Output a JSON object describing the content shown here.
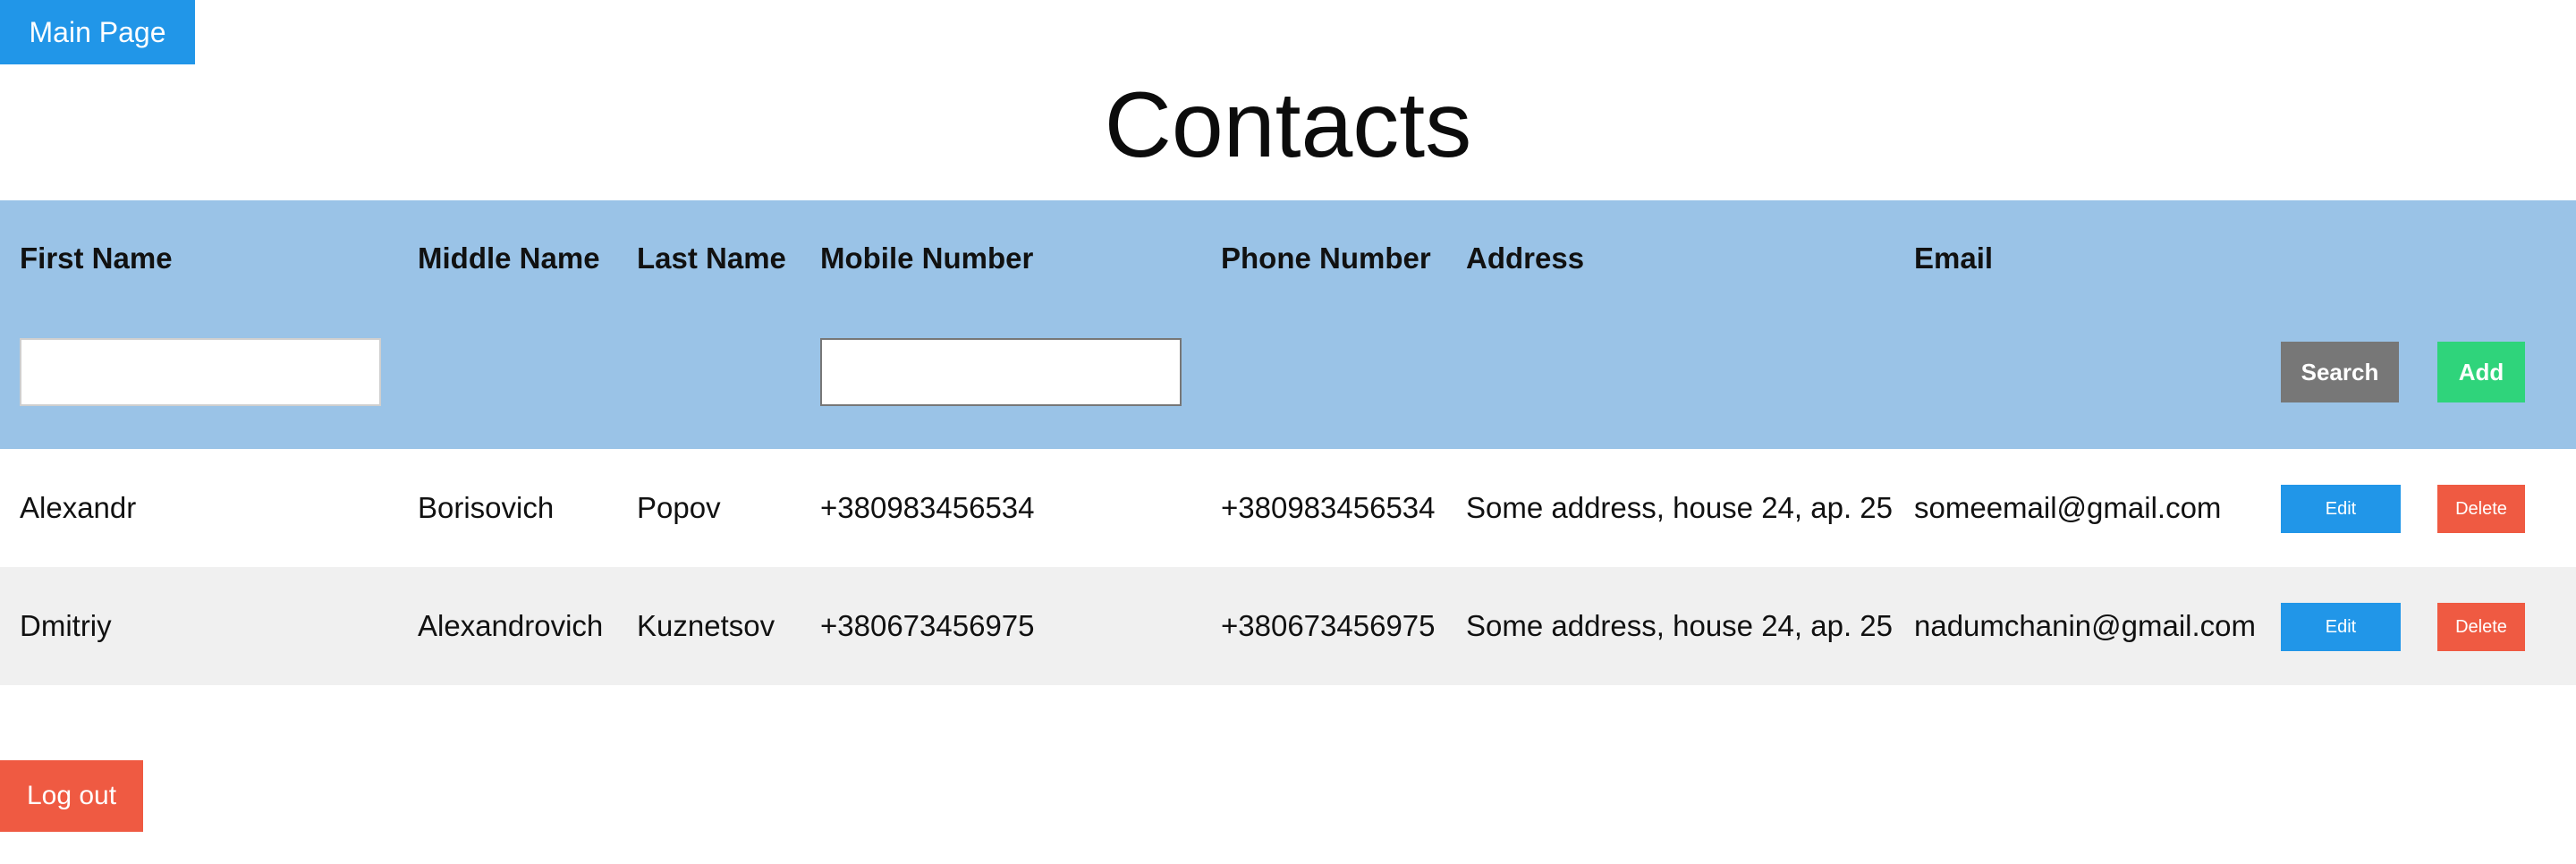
{
  "nav": {
    "main_page_label": "Main Page",
    "logout_label": "Log out"
  },
  "page": {
    "title": "Contacts"
  },
  "table": {
    "headers": {
      "first_name": "First Name",
      "middle_name": "Middle Name",
      "last_name": "Last Name",
      "mobile_number": "Mobile Number",
      "phone_number": "Phone Number",
      "address": "Address",
      "email": "Email"
    },
    "filters": {
      "first_name_value": "",
      "mobile_number_value": ""
    },
    "search_label": "Search",
    "add_label": "Add",
    "edit_label": "Edit",
    "delete_label": "Delete",
    "rows": [
      {
        "first_name": "Alexandr",
        "middle_name": "Borisovich",
        "last_name": "Popov",
        "mobile_number": "+380983456534",
        "phone_number": "+380983456534",
        "address": "Some address, house 24, ap. 25",
        "email": "someemail@gmail.com"
      },
      {
        "first_name": "Dmitriy",
        "middle_name": "Alexandrovich",
        "last_name": "Kuznetsov",
        "mobile_number": "+380673456975",
        "phone_number": "+380673456975",
        "address": "Some address, house 24, ap. 25",
        "email": "nadumchanin@gmail.com"
      }
    ]
  },
  "colors": {
    "primary": "#2196e8",
    "danger": "#ef5a42",
    "success": "#2fd47b",
    "neutral": "#777777",
    "header_bg": "#9ac3e7",
    "row_alt_bg": "#f0f0f0"
  }
}
